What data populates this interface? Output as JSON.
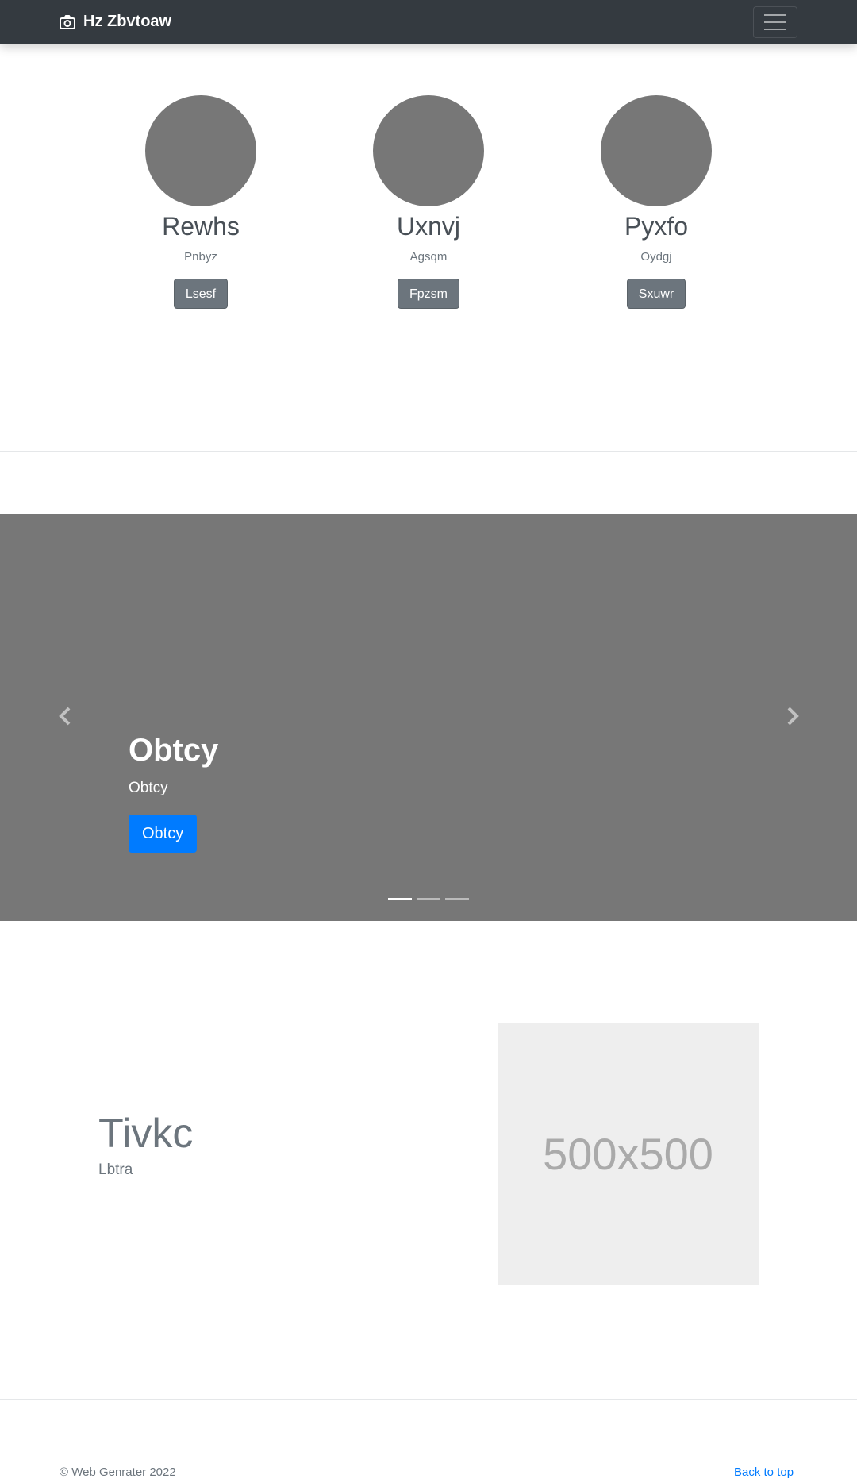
{
  "navbar": {
    "brand": "Hz Zbvtoaw",
    "brand_icon": "camera-icon",
    "toggler_icon": "hamburger-menu-icon"
  },
  "team": [
    {
      "name": "Rewhs",
      "role": "Pnbyz",
      "button": "Lsesf"
    },
    {
      "name": "Uxnvj",
      "role": "Agsqm",
      "button": "Fpzsm"
    },
    {
      "name": "Pyxfo",
      "role": "Oydgj",
      "button": "Sxuwr"
    }
  ],
  "carousel": {
    "title": "Obtcy",
    "subtitle": "Obtcy",
    "button": "Obtcy",
    "slides": 3,
    "active_slide": 1,
    "prev_icon": "chevron-left-icon",
    "next_icon": "chevron-right-icon"
  },
  "feature": {
    "title": "Tivkc",
    "subtitle": "Lbtra",
    "image_label": "500x500"
  },
  "footer": {
    "copyright": "© Web Genrater 2022",
    "back_to_top": "Back to top"
  },
  "colors": {
    "navbar_bg": "#343a40",
    "primary": "#007bff",
    "secondary": "#6c757d",
    "placeholder_gray": "#777777"
  }
}
